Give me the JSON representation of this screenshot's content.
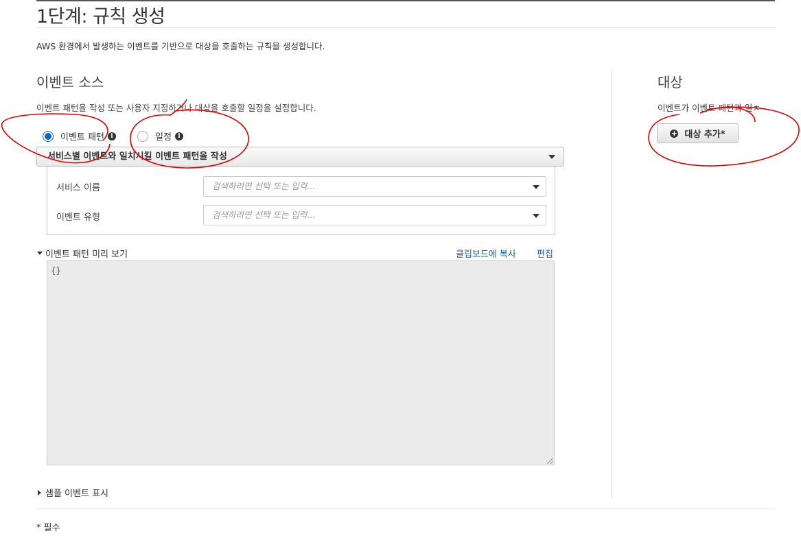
{
  "page": {
    "title": "1단계: 규칙 생성",
    "description": "AWS 환경에서 발생하는 이벤트를 기반으로 대상을 호출하는 규칙을 생성합니다."
  },
  "event_source": {
    "heading": "이벤트 소스",
    "description": "이벤트 패턴을 작성 또는 사용자 지정하거나 대상을 호출할 일정을 설정합니다.",
    "radio_event_pattern": "이벤트 패턴",
    "radio_schedule": "일정",
    "selected": "이벤트 패턴",
    "pattern_select": "서비스별 이벤트와 일치시킬 이벤트 패턴을 작성",
    "service_name_label": "서비스 이름",
    "event_type_label": "이벤트 유형",
    "input_placeholder": "검색하려면 선택 또는 입력...",
    "preview_toggle": "이벤트 패턴 미리 보기",
    "copy_link": "클립보드에 복사",
    "edit_link": "편집",
    "preview_content": "{}",
    "sample_toggle": "샘플 이벤트 표시"
  },
  "targets": {
    "heading": "대상",
    "description": "이벤트가 이벤트 패턴과 일ㅊ",
    "add_button": "대상 추가*"
  },
  "footer": {
    "required_note": "* 필수"
  },
  "icons": {
    "info": "info-icon",
    "caret": "chevron-down-icon",
    "add": "plus-circle-icon"
  },
  "colors": {
    "link": "#1560bd",
    "radio_selected": "#1664c9",
    "annotation": "#e00000"
  }
}
